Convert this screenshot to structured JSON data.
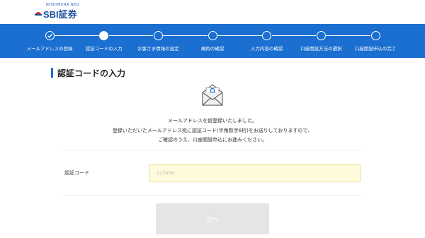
{
  "brand": {
    "small_text": "NISHIMURA NEO",
    "name": "SBI証券",
    "color": "#1e4fa0"
  },
  "stepbar": {
    "color": "#1a6fd0",
    "steps": [
      {
        "label": "メールアドレスの登録",
        "state": "done"
      },
      {
        "label": "認証コードの入力",
        "state": "current"
      },
      {
        "label": "お客さま情報の設定",
        "state": "todo"
      },
      {
        "label": "規約の確認",
        "state": "todo"
      },
      {
        "label": "入力内容の確認",
        "state": "todo"
      },
      {
        "label": "口座開設方法の選択",
        "state": "todo"
      },
      {
        "label": "口座開設申込の完了",
        "state": "todo"
      }
    ]
  },
  "page": {
    "title": "認証コードの入力",
    "mail_icon": "envelope-lock-icon",
    "message_lines": [
      "メールアドレスを仮登録いたしました。",
      "登録いただいたメールアドレス宛に認証コード(半角数字6桁)をお送りしておりますので、",
      "ご確認のうえ、口座開設申込にお進みください。"
    ]
  },
  "form": {
    "code_label": "認証コード",
    "code_placeholder": "123456",
    "code_value": "",
    "input_bg": "#fdfbdc"
  },
  "actions": {
    "next_label": "次へ",
    "next_disabled": true
  }
}
